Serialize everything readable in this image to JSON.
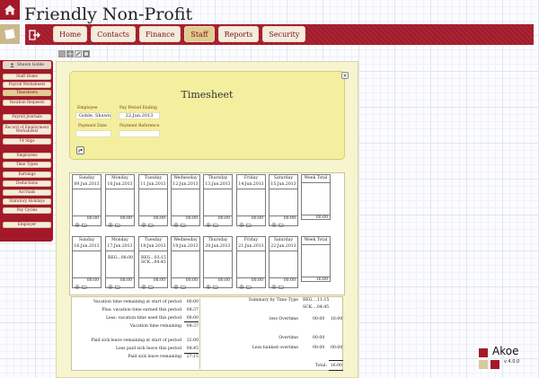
{
  "app": {
    "title": "Friendly Non-Profit"
  },
  "nav": {
    "tabs": [
      {
        "label": "Home"
      },
      {
        "label": "Contacts"
      },
      {
        "label": "Finance"
      },
      {
        "label": "Staff"
      },
      {
        "label": "Reports"
      },
      {
        "label": "Security"
      }
    ],
    "active": "Staff"
  },
  "sidebar": {
    "user": "Shawn Goble",
    "items": {
      "staff_home": "Staff Home",
      "payroll_worksheets": "Payroll Worksheets",
      "timesheets": "Timesheets",
      "vacation_requests": "Vacation Requests",
      "payroll_journals": "Payroll Journals",
      "record_of_employment": "Record of Employment Worksheets",
      "t4_slips": "T4 Slips",
      "employees": "Employees",
      "time_types": "Time Types",
      "earnings": "Earnings",
      "deductions": "Deductions",
      "accruals": "Accruals",
      "statutory_holidays": "Statutory Holidays",
      "pay_cycles": "Pay Cycles",
      "employer": "Employer"
    }
  },
  "timesheet": {
    "title": "Timesheet",
    "employee_label": "Employee",
    "employee_value": "Goble, Shawn",
    "pay_period_label": "Pay Period Ending",
    "pay_period_value": "22.Jun.2013",
    "payment_date_label": "Payment Date",
    "payment_date_value": "",
    "payment_reference_label": "Payment Reference",
    "payment_reference_value": ""
  },
  "weeks": [
    {
      "days": [
        {
          "name": "Sunday",
          "date": "09.Jun.2013",
          "entries": "",
          "total": "00:00"
        },
        {
          "name": "Monday",
          "date": "10.Jun.2013",
          "entries": "",
          "total": "00:00"
        },
        {
          "name": "Tuesday",
          "date": "11.Jun.2013",
          "entries": "",
          "total": "00:00"
        },
        {
          "name": "Wednesday",
          "date": "12.Jun.2013",
          "entries": "",
          "total": "00:00"
        },
        {
          "name": "Thursday",
          "date": "13.Jun.2013",
          "entries": "",
          "total": "00:00"
        },
        {
          "name": "Friday",
          "date": "14.Jun.2013",
          "entries": "",
          "total": "00:00"
        },
        {
          "name": "Saturday",
          "date": "15.Jun.2013",
          "entries": "",
          "total": "00:00"
        }
      ],
      "week_total_label": "Week Total",
      "week_total": "00:00"
    },
    {
      "days": [
        {
          "name": "Sunday",
          "date": "16.Jun.2013",
          "entries": "",
          "total": "00:00"
        },
        {
          "name": "Monday",
          "date": "17.Jun.2013",
          "entries": "REG...08:00",
          "total": "08:00"
        },
        {
          "name": "Tuesday",
          "date": "18.Jun.2013",
          "entries": "REG...03:15\nSCK...04:45",
          "total": "08:00"
        },
        {
          "name": "Wednesday",
          "date": "19.Jun.2013",
          "entries": "",
          "total": "00:00"
        },
        {
          "name": "Thursday",
          "date": "20.Jun.2013",
          "entries": "",
          "total": "00:00"
        },
        {
          "name": "Friday",
          "date": "21.Jun.2013",
          "entries": "",
          "total": "00:00"
        },
        {
          "name": "Saturday",
          "date": "22.Jun.2013",
          "entries": "",
          "total": "00:00"
        }
      ],
      "week_total_label": "Week Total",
      "week_total": "16:00"
    }
  ],
  "summary": {
    "vac_remaining_start_label": "Vacation time remaining at start of period",
    "vac_remaining_start": "00:00",
    "vac_earned_label": "Plus: vacation time earned this period",
    "vac_earned": "04:37",
    "vac_used_label": "Less: vacation time used this period",
    "vac_used": "00:00",
    "vac_remaining_label": "Vacation time remaining",
    "vac_remaining": "04:37",
    "sick_start_label": "Paid sick leave remaining at start of period",
    "sick_start": "32:00",
    "sick_used_label": "Less paid sick leave this period",
    "sick_used": "04:45",
    "sick_remaining_label": "Paid sick leave remaining",
    "sick_remaining": "27:15",
    "by_type_label": "Summary by Time Type",
    "by_type_reg": "REG....11:15",
    "by_type_sck": "SCK....04:45",
    "less_overtime_label": "less Overtime",
    "less_overtime_a": "00:00",
    "less_overtime_b": "16:00",
    "overtime_label": "Overtime",
    "overtime": "00:00",
    "less_banked_label": "Less banked overtime",
    "less_banked_a": "00:00",
    "less_banked_b": "00:00",
    "total_label": "Total:",
    "total": "16:00"
  },
  "brand": {
    "name": "Akoe",
    "version": "v 4.0.0",
    "colors": {
      "red": "#a3192a",
      "tan": "#d9c89a",
      "cream": "#f7f4d0"
    }
  }
}
